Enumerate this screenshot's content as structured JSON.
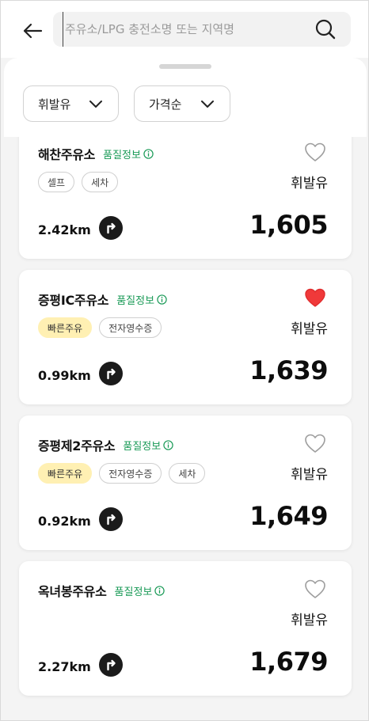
{
  "search": {
    "placeholder": "주유소/LPG 충전소명 또는 지역명",
    "value": ""
  },
  "filters": {
    "fuel_label": "휘발유",
    "sort_label": "가격순"
  },
  "stations": [
    {
      "name": "해찬주유소",
      "quality_label": "품질정보",
      "tags": [
        {
          "text": "셀프",
          "highlight": false
        },
        {
          "text": "세차",
          "highlight": false
        }
      ],
      "favorite": false,
      "fuel_type": "휘발유",
      "distance": "2.42km",
      "price": "1,605"
    },
    {
      "name": "증평IC주유소",
      "quality_label": "품질정보",
      "tags": [
        {
          "text": "빠른주유",
          "highlight": true
        },
        {
          "text": "전자영수증",
          "highlight": false
        }
      ],
      "favorite": true,
      "fuel_type": "휘발유",
      "distance": "0.99km",
      "price": "1,639"
    },
    {
      "name": "증평제2주유소",
      "quality_label": "품질정보",
      "tags": [
        {
          "text": "빠른주유",
          "highlight": true
        },
        {
          "text": "전자영수증",
          "highlight": false
        },
        {
          "text": "세차",
          "highlight": false
        }
      ],
      "favorite": false,
      "fuel_type": "휘발유",
      "distance": "0.92km",
      "price": "1,649"
    },
    {
      "name": "옥녀봉주유소",
      "quality_label": "품질정보",
      "tags": [],
      "favorite": false,
      "fuel_type": "휘발유",
      "distance": "2.27km",
      "price": "1,679"
    }
  ],
  "colors": {
    "accent_green": "#1a9a57",
    "favorite_red": "#f0393a",
    "tag_highlight": "#fff0b3"
  },
  "icons": {
    "back": "arrow-left-icon",
    "search": "magnifier-icon",
    "dropdown": "chevron-down-icon",
    "info": "info-circle-icon",
    "favorite": "heart-icon",
    "route": "directions-icon"
  }
}
